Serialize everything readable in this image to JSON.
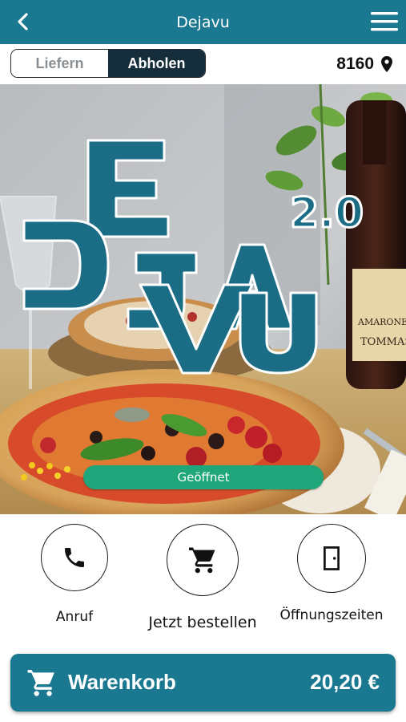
{
  "header": {
    "title": "Dejavu",
    "back_icon": "chevron-left-icon",
    "menu_icon": "hamburger-menu-icon",
    "background_color": "#1a7891"
  },
  "order_mode": {
    "options": [
      "Liefern",
      "Abholen"
    ],
    "selected": "Abholen"
  },
  "location": {
    "postal_code": "8160",
    "icon": "map-pin-icon"
  },
  "hero": {
    "logo_text_1": "DEJA",
    "logo_text_2": "VU",
    "logo_version": "2.0",
    "status": "Geöffnet",
    "status_color": "#1fa67a"
  },
  "actions": [
    {
      "label": "Anruf",
      "icon": "phone-icon"
    },
    {
      "label": "Jetzt bestellen",
      "icon": "cart-icon"
    },
    {
      "label": "Öffnungszeiten",
      "icon": "door-icon"
    }
  ],
  "cart": {
    "label": "Warenkorb",
    "total": "20,20 €",
    "icon": "cart-icon"
  }
}
